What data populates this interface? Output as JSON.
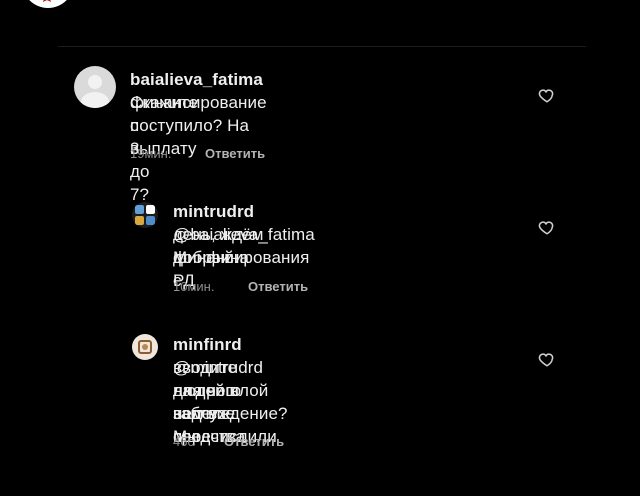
{
  "comments": [
    {
      "username": "baialieva_fatima",
      "lines": [
        "Скажите",
        "финансирование поступило? На выплату",
        "с 3 до 7?"
      ],
      "time": "19мин.",
      "reply_label": "Ответить"
    },
    {
      "username": "mintrudrd",
      "lines": [
        "@baialieva_fatima добрый",
        "день, ждём финансирования с",
        "Минфина РД"
      ],
      "time": "10мин.",
      "reply_label": "Ответить"
    },
    {
      "username": "minfinrd",
      "lines": [
        "@mintrudrd для чего вы",
        "вводите людей в заблуждение? Мы",
        "на прошлой неделе перечислили",
        "вам все средства"
      ],
      "time": "46с",
      "reply_label": "Ответить"
    }
  ],
  "icons": {
    "like": "heart-outline-icon",
    "profile_placeholder": "default-avatar-icon"
  },
  "colors": {
    "background": "#000000",
    "text": "#efefef",
    "meta": "#8f8f8f",
    "reply": "#b4b4b4"
  }
}
